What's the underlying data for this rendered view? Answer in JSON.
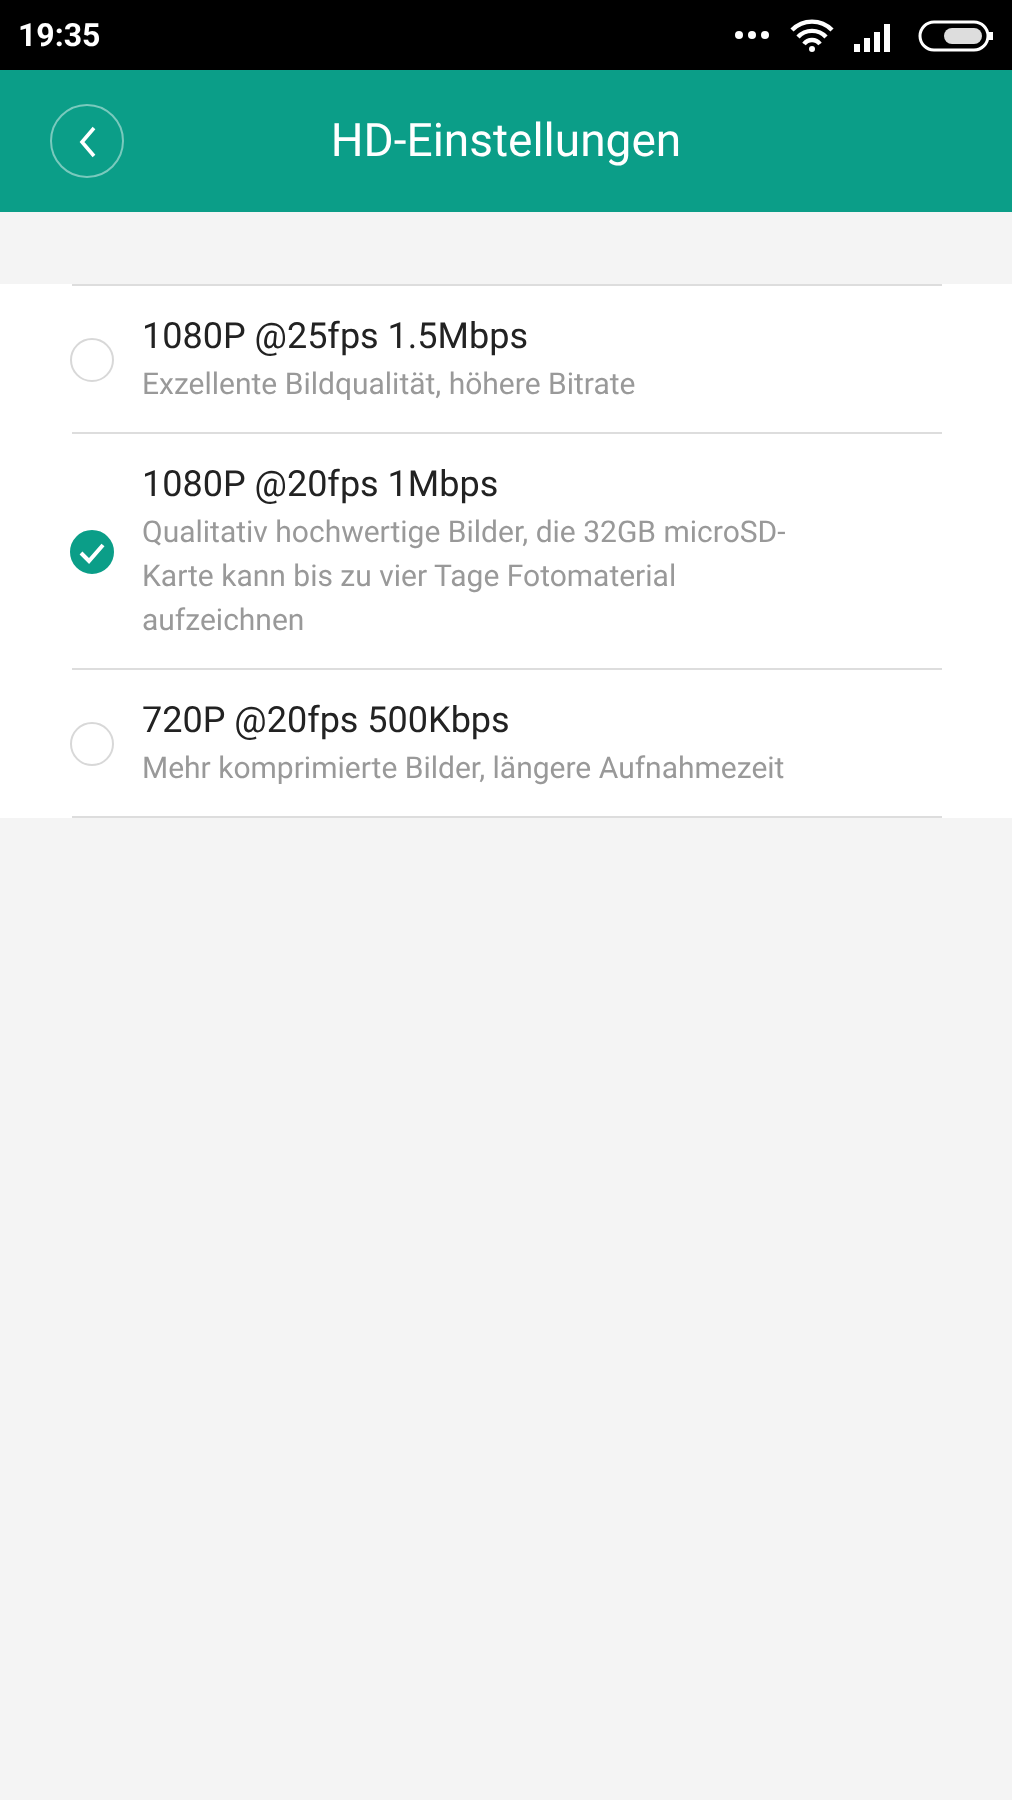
{
  "status_bar": {
    "time": "19:35"
  },
  "header": {
    "title": "HD-Einstellungen"
  },
  "options": [
    {
      "label": "1080P @25fps 1.5Mbps",
      "description": "Exzellente Bildqualität, höhere Bitrate",
      "selected": false
    },
    {
      "label": "1080P @20fps 1Mbps",
      "description": "Qualitativ hochwertige Bilder, die 32GB microSD-Karte kann bis zu vier Tage Fotomaterial aufzeichnen",
      "selected": true
    },
    {
      "label": "720P @20fps 500Kbps",
      "description": "Mehr komprimierte Bilder, längere Aufnahmezeit",
      "selected": false
    }
  ]
}
